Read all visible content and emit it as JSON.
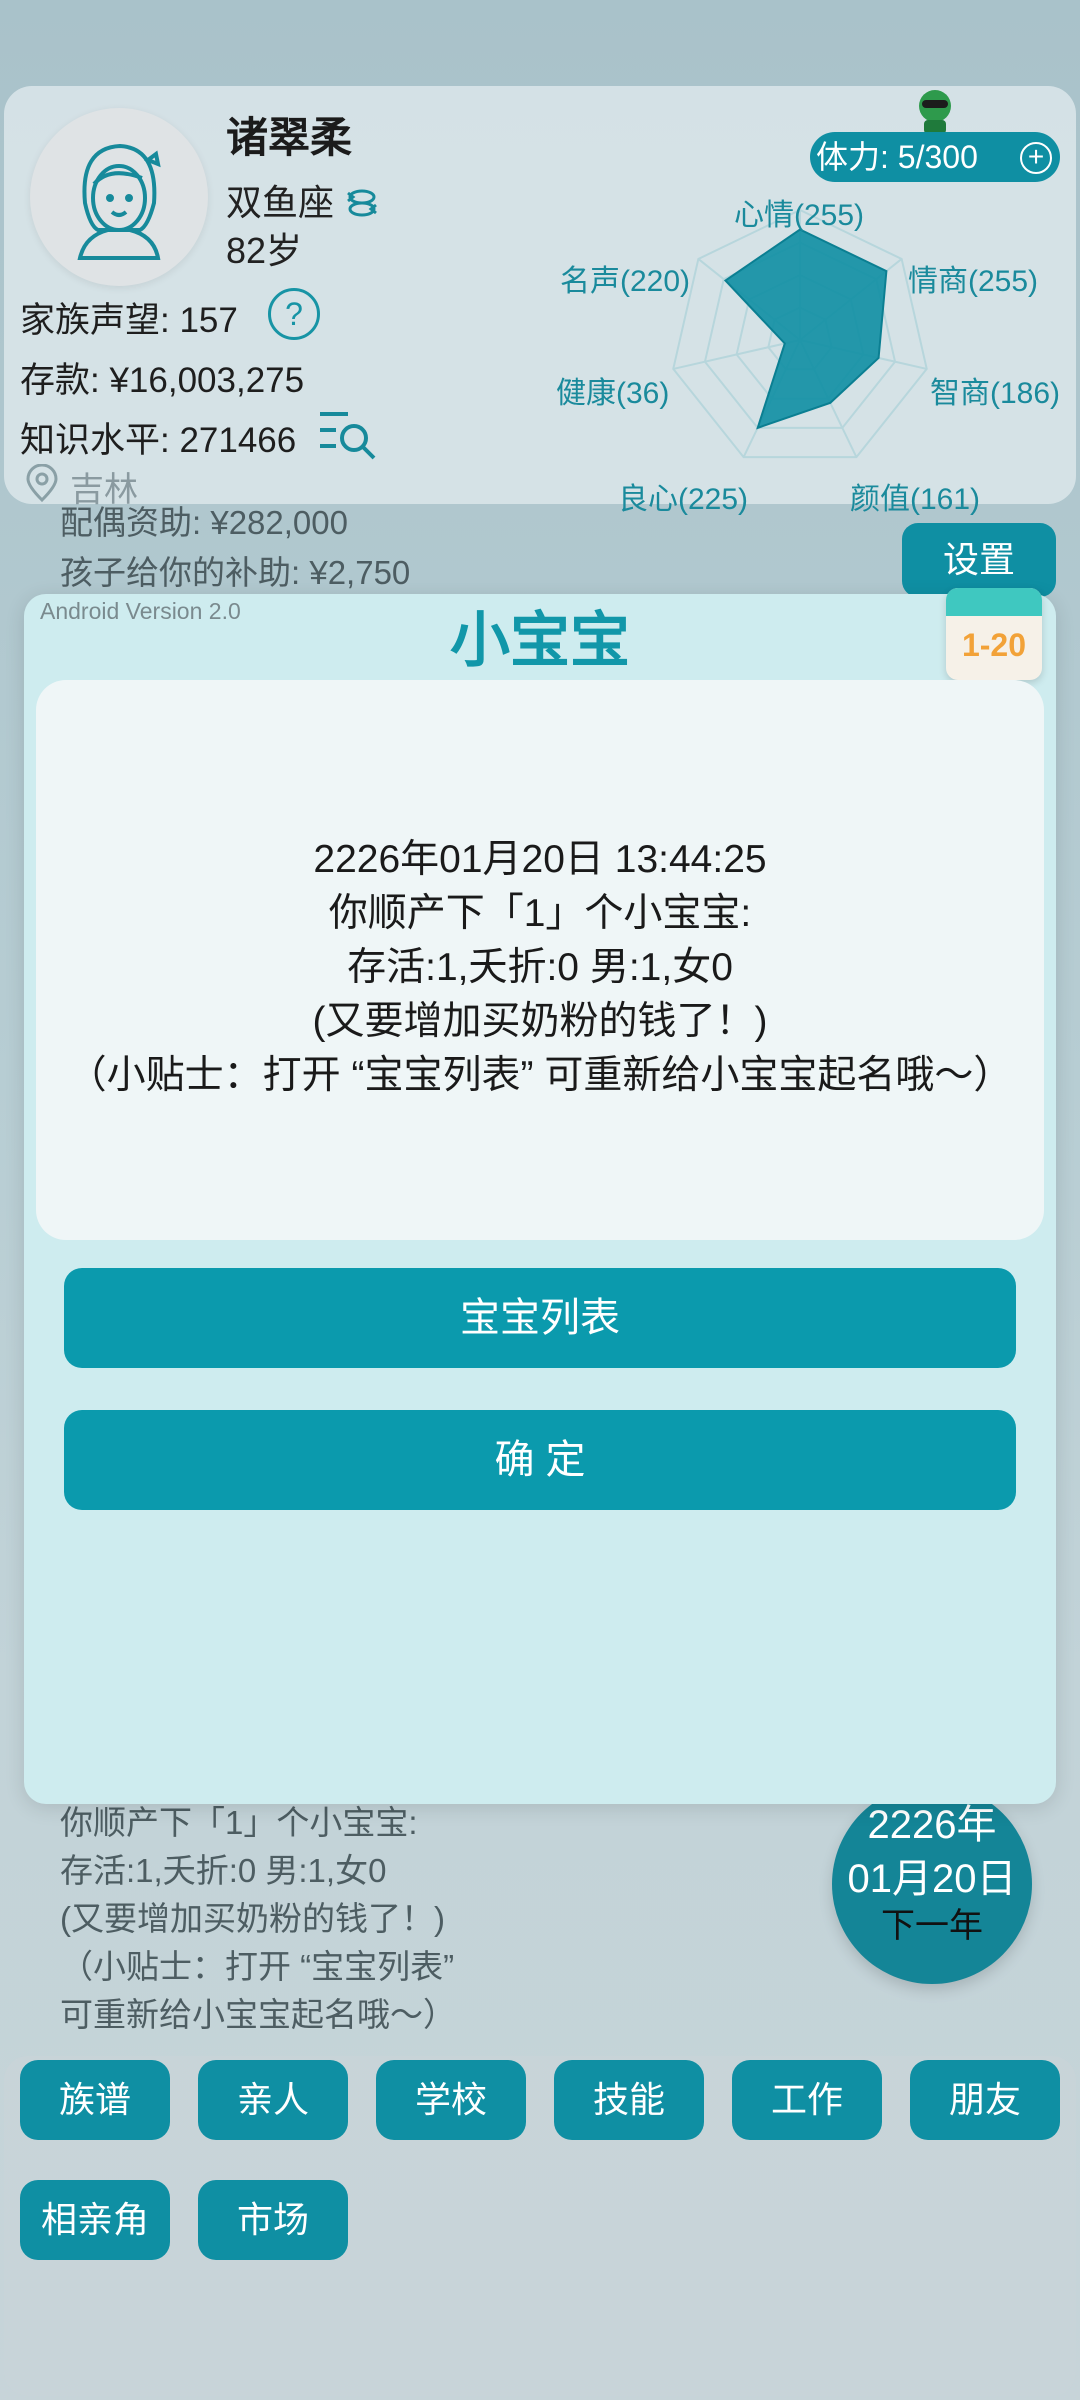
{
  "profile": {
    "name": "诸翠柔",
    "zodiac": "双鱼座",
    "age": "82岁",
    "reputation": "家族声望: 157",
    "savings": "存款: ¥16,003,275",
    "knowledge": "知识水平: 271466",
    "location": "吉林",
    "stamina": "体力: 5/300"
  },
  "radar": {
    "mood": "心情(255)",
    "eq": "情商(255)",
    "iq": "智商(186)",
    "looks": "颜值(161)",
    "conscience": "良心(225)",
    "health": "健康(36)",
    "fame": "名声(220)",
    "values": {
      "mood": 255,
      "eq": 255,
      "iq": 186,
      "looks": 161,
      "conscience": 225,
      "health": 36,
      "fame": 220
    },
    "max": 300
  },
  "background": {
    "spouse_support": "配偶资助: ¥282,000",
    "child_allowance": "孩子给你的补助: ¥2,750",
    "settings": "设置",
    "log_lines": [
      "你顺产下「1」个小宝宝:",
      "存活:1,夭折:0  男:1,女0",
      "(又要增加买奶粉的钱了！)",
      "（小贴士：打开 “宝宝列表”",
      "可重新给小宝宝起名哦～）"
    ],
    "date_year": "2226年",
    "date_day": "01月20日",
    "next_year": "下一年"
  },
  "nav": {
    "items": [
      "族谱",
      "亲人",
      "学校",
      "技能",
      "工作",
      "朋友",
      "相亲角",
      "市场"
    ]
  },
  "modal": {
    "version": "Android Version 2.0",
    "title": "小宝宝",
    "calendar": "1-20",
    "lines": [
      "2226年01月20日 13:44:25",
      "你顺产下「1」个小宝宝:",
      "存活:1,夭折:0  男:1,女0",
      "(又要增加买奶粉的钱了！)",
      "（小贴士：打开 “宝宝列表” 可重新给小宝宝起名哦～）"
    ],
    "baby_list_button": "宝宝列表",
    "confirm_button": "确  定"
  },
  "colors": {
    "accent": "#0b9aad",
    "radar_fill": "#0f8fa3"
  }
}
